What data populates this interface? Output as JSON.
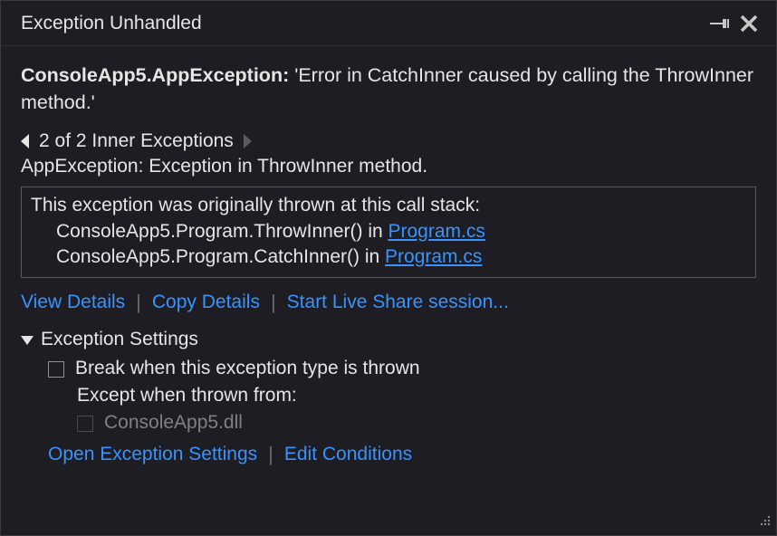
{
  "titlebar": {
    "title": "Exception Unhandled"
  },
  "exception": {
    "type": "ConsoleApp5.AppException:",
    "message": "'Error in CatchInner caused by calling the ThrowInner method.'"
  },
  "inner_nav": {
    "label": "2 of 2 Inner Exceptions"
  },
  "inner_exception": "AppException: Exception in ThrowInner method.",
  "stack": {
    "intro": "This exception was originally thrown at this call stack:",
    "frames": [
      {
        "text": "ConsoleApp5.Program.ThrowInner() in ",
        "link": "Program.cs"
      },
      {
        "text": "ConsoleApp5.Program.CatchInner() in ",
        "link": "Program.cs"
      }
    ]
  },
  "actions": {
    "view_details": "View Details",
    "copy_details": "Copy Details",
    "live_share": "Start Live Share session..."
  },
  "settings": {
    "heading": "Exception Settings",
    "break_label": "Break when this exception type is thrown",
    "except_label": "Except when thrown from:",
    "module": "ConsoleApp5.dll",
    "open": "Open Exception Settings",
    "edit": "Edit Conditions"
  }
}
